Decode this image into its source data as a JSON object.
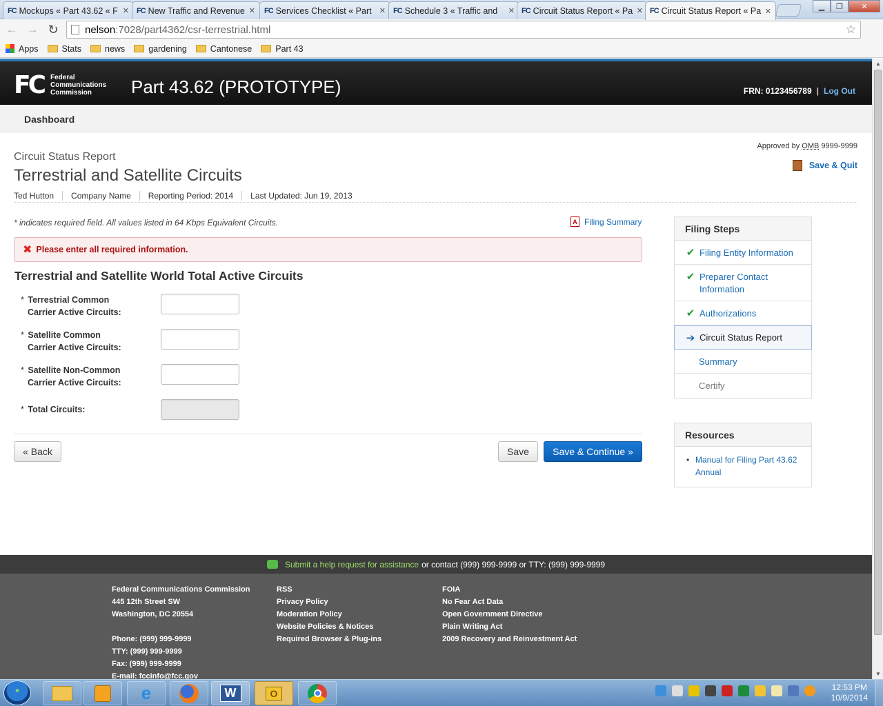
{
  "browser": {
    "tabs": [
      {
        "favicon": "FC",
        "title": "Mockups « Part 43.62 « F"
      },
      {
        "favicon": "FC",
        "title": "New Traffic and Revenue"
      },
      {
        "favicon": "FC",
        "title": "Services Checklist « Part"
      },
      {
        "favicon": "FC",
        "title": "Schedule 3 « Traffic and"
      },
      {
        "favicon": "FC",
        "title": "Circuit Status Report « Pa"
      },
      {
        "favicon": "FC",
        "title": "Circuit Status Report « Pa"
      }
    ],
    "url_host": "nelson",
    "url_path": ":7028/part4362/csr-terrestrial.html",
    "bookmarks": [
      {
        "label": "Apps",
        "icon": "apps-grid-icon"
      },
      {
        "label": "Stats",
        "icon": "folder-icon"
      },
      {
        "label": "news",
        "icon": "folder-icon"
      },
      {
        "label": "gardening",
        "icon": "folder-icon"
      },
      {
        "label": "Cantonese",
        "icon": "folder-icon"
      },
      {
        "label": "Part 43",
        "icon": "folder-icon"
      }
    ]
  },
  "header": {
    "logo_mark": "FC",
    "agency_line1": "Federal",
    "agency_line2": "Communications",
    "agency_line3": "Commission",
    "app_title": "Part 43.62 (PROTOTYPE)",
    "frn": "FRN: 0123456789",
    "separator": "|",
    "logout": "Log Out"
  },
  "nav": {
    "dashboard": "Dashboard"
  },
  "page": {
    "omb_prefix": "Approved by",
    "omb_abbr": "OMB",
    "omb_number": "9999-9999",
    "save_quit": "Save & Quit",
    "breadcrumb": "Circuit Status Report",
    "title": "Terrestrial and Satellite Circuits",
    "meta": {
      "user": "Ted Hutton",
      "company": "Company Name",
      "period": "Reporting Period: 2014",
      "updated": "Last Updated: Jun 19, 2013"
    },
    "note": "* indicates required field. All values listed in 64 Kbps Equivalent Circuits.",
    "filing_summary": "Filing Summary",
    "alert": "Please enter all required information.",
    "section_title": "Terrestrial and Satellite World Total Active Circuits",
    "fields": [
      {
        "line1": "Terrestrial Common",
        "line2": "Carrier Active Circuits:",
        "value": ""
      },
      {
        "line1": "Satellite Common",
        "line2": "Carrier Active Circuits:",
        "value": ""
      },
      {
        "line1": "Satellite Non-Common",
        "line2": "Carrier Active Circuits:",
        "value": ""
      },
      {
        "line1": "Total Circuits:",
        "line2": "",
        "value": ""
      }
    ],
    "required_marker": "*",
    "back_button": "« Back",
    "save_button": "Save",
    "save_continue_button": "Save & Continue »"
  },
  "sidebar": {
    "steps_title": "Filing Steps",
    "steps": [
      {
        "label": "Filing Entity Information",
        "status": "complete"
      },
      {
        "label": "Preparer Contact Information",
        "status": "complete"
      },
      {
        "label": "Authorizations",
        "status": "complete"
      },
      {
        "label": "Circuit Status Report",
        "status": "current"
      },
      {
        "label": "Summary",
        "status": "pending"
      },
      {
        "label": "Certify",
        "status": "pending"
      }
    ],
    "resources_title": "Resources",
    "resources": [
      "Manual for Filing Part 43.62 Annual"
    ]
  },
  "footer": {
    "help_link": "Submit a help request for assistance",
    "help_text": "or contact (999) 999-9999 or TTY: (999) 999-9999",
    "col1": [
      "Federal Communications Commission",
      "445 12th Street SW",
      "Washington, DC 20554",
      "",
      "Phone: (999) 999-9999",
      "TTY: (999) 999-9999",
      "Fax: (999) 999-9999",
      "E-mail: fccinfo@fcc.gov"
    ],
    "col2": [
      "RSS",
      "Privacy Policy",
      "Moderation Policy",
      "Website Policies & Notices",
      "Required Browser & Plug-ins"
    ],
    "col3": [
      "FOIA",
      "No Fear Act Data",
      "Open Government Directive",
      "Plain Writing Act",
      "2009 Recovery and Reinvestment Act"
    ]
  },
  "taskbar": {
    "time": "12:53 PM",
    "date": "10/9/2014",
    "apps": [
      "file-explorer-icon",
      "media-player-icon",
      "internet-explorer-icon",
      "firefox-icon",
      "word-icon",
      "outlook-icon",
      "chrome-icon"
    ]
  },
  "colors": {
    "brand_blue": "#1a6bb4",
    "header_bg": "#111111",
    "primary_button": "#0b5fb3",
    "error_text": "#aa1111",
    "success_check": "#2a9b3a"
  }
}
